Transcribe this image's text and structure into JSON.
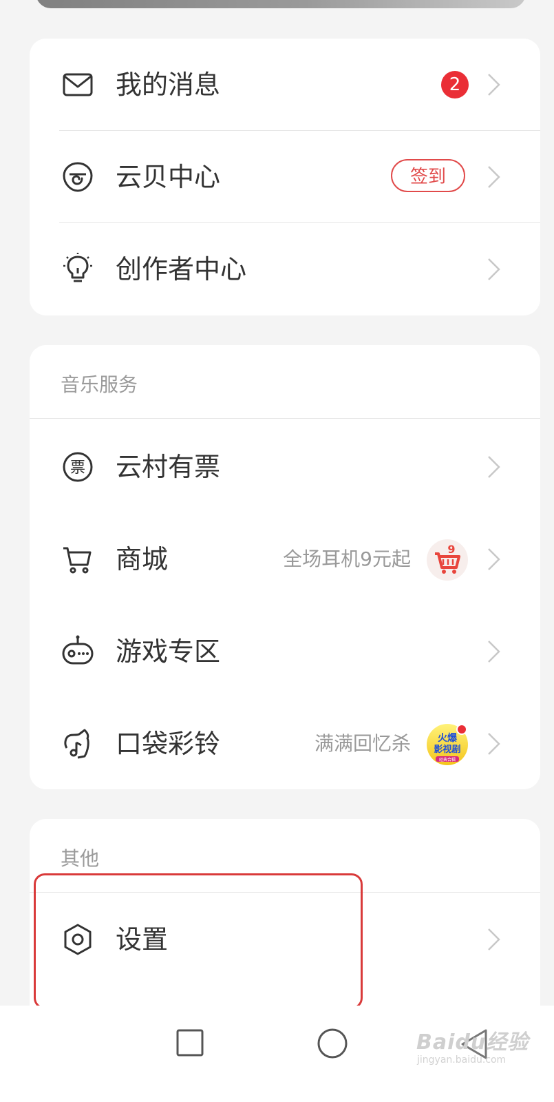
{
  "account_section": {
    "items": [
      {
        "label": "我的消息",
        "icon": "mail-icon",
        "badge": "2"
      },
      {
        "label": "云贝中心",
        "icon": "cloud-coin-icon",
        "tag": "签到"
      },
      {
        "label": "创作者中心",
        "icon": "lightbulb-icon"
      }
    ]
  },
  "music_services": {
    "title": "音乐服务",
    "items": [
      {
        "label": "云村有票",
        "icon": "ticket-icon"
      },
      {
        "label": "商城",
        "icon": "cart-icon",
        "promo": "全场耳机9元起",
        "promo_image": "cart-promo-image"
      },
      {
        "label": "游戏专区",
        "icon": "game-icon"
      },
      {
        "label": "口袋彩铃",
        "icon": "ringtone-icon",
        "promo": "满满回忆杀",
        "promo_image": "hot-movie-badge"
      }
    ]
  },
  "other": {
    "title": "其他",
    "items": [
      {
        "label": "设置",
        "icon": "settings-icon"
      }
    ]
  },
  "promo_image_text": {
    "hot_line1": "火爆",
    "hot_line2": "影视剧",
    "hot_line3": "经典合辑"
  },
  "watermark": {
    "brand": "Baidu经验",
    "url": "jingyan.baidu.com"
  },
  "colors": {
    "accent_red": "#ea2e36",
    "highlight_box": "#d93a3a",
    "background": "#f4f4f4"
  }
}
